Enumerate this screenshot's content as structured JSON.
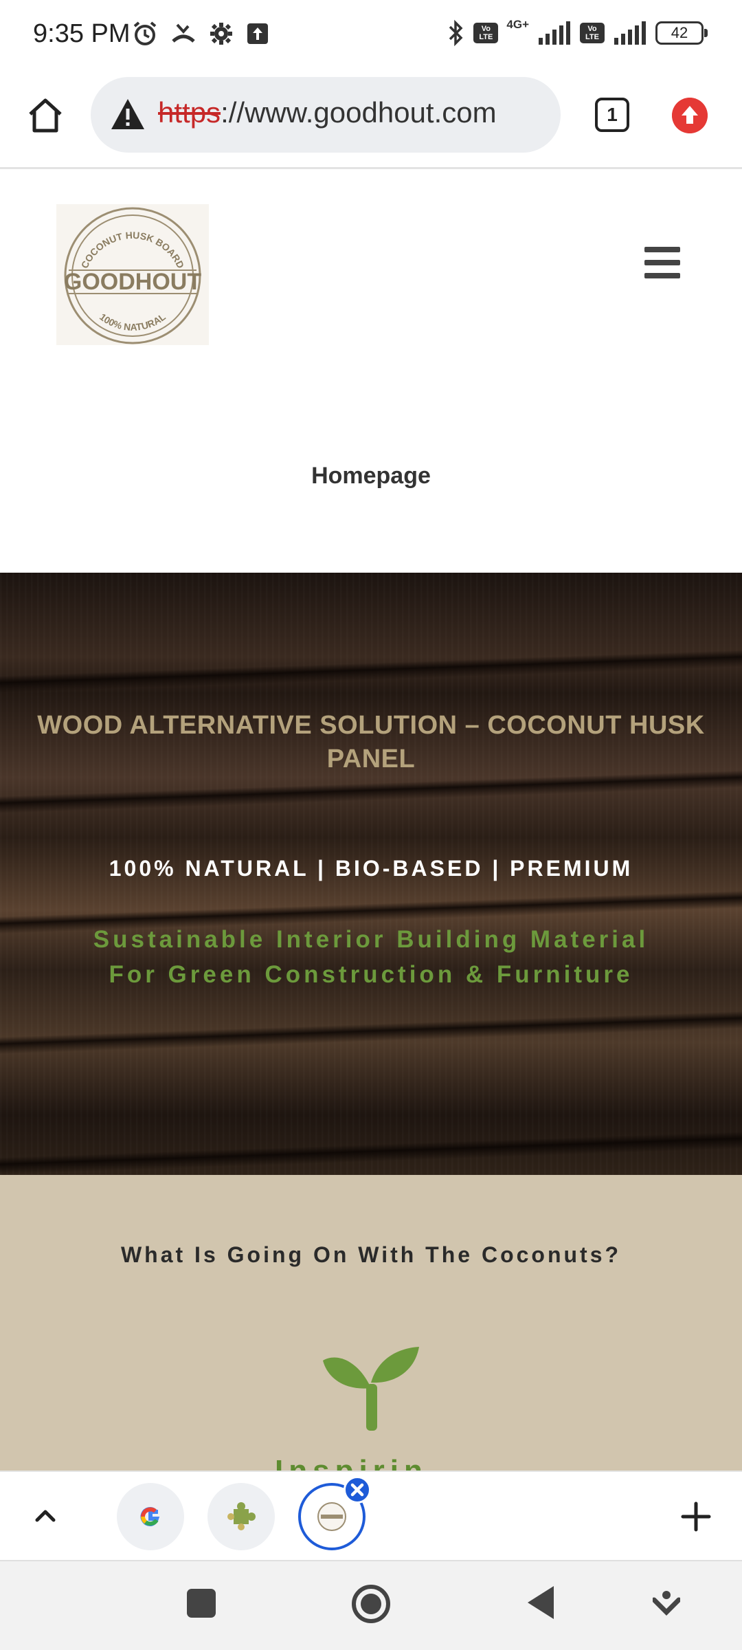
{
  "status_bar": {
    "time": "9:35 PM",
    "network_type": "4G+",
    "volte_label": "Vo LTE",
    "battery_level": "42",
    "icons": [
      "alarm-icon",
      "missed-call-icon",
      "settings-icon",
      "upload-icon",
      "bluetooth-icon",
      "signal-icon",
      "signal-icon",
      "battery-icon"
    ]
  },
  "browser": {
    "url_scheme": "https",
    "url_rest": "://www.goodhout.com",
    "tab_count": "1",
    "icons": [
      "home-icon",
      "warning-icon",
      "tab-switcher-icon",
      "update-icon"
    ]
  },
  "site": {
    "logo_alt": "GOODHOUT",
    "logo_text": {
      "top": "COCONUT HUSK BOARD",
      "middle": "GOODHOUT",
      "bottom": "100% NATURAL"
    },
    "page_title": "Homepage",
    "hero": {
      "title": "WOOD ALTERNATIVE SOLUTION – COCONUT HUSK PANEL",
      "tagline": "100% NATURAL | BIO-BASED | PREMIUM",
      "subtitle": "Sustainable Interior Building Material For Green Construction & Furniture"
    },
    "section": {
      "heading": "What Is Going On With The Coconuts?",
      "cut_off_text": "Inspiring"
    }
  },
  "tab_strip": {
    "icons": [
      "chevron-up-icon",
      "google-tab-icon",
      "puzzle-tab-icon",
      "goodhout-tab-icon",
      "close-icon",
      "plus-icon"
    ]
  },
  "nav_bar": {
    "icons": [
      "recents-icon",
      "home-icon",
      "back-icon",
      "assistant-icon"
    ]
  },
  "colors": {
    "hero_title": "#b4a27c",
    "hero_subtitle": "#6c9a3c",
    "section_bg": "#d1c5ae",
    "sprout": "#6c9a3c",
    "tab_active": "#1e5bd8",
    "update_red": "#e53935"
  }
}
